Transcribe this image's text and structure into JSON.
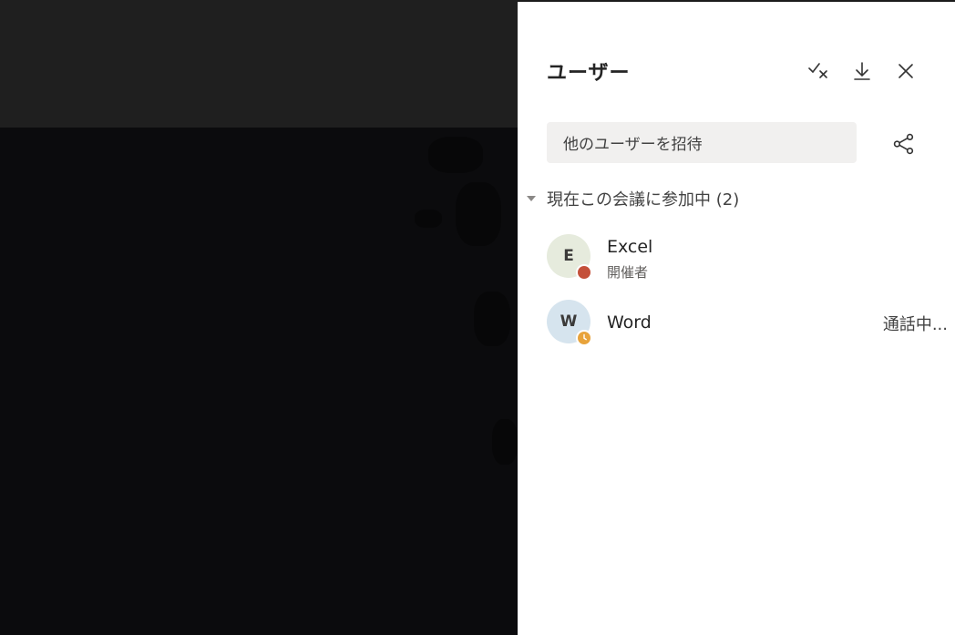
{
  "panel": {
    "title": "ユーザー",
    "actions": [
      "checkmark-x-icon",
      "download-icon",
      "close-icon"
    ],
    "invite_placeholder": "他のユーザーを招待",
    "section_label": "現在この会議に参加中 (2)",
    "participants": [
      {
        "initial": "E",
        "name": "Excel",
        "role": "開催者",
        "status": "",
        "avatar_bg": "#e6ebdd",
        "presence": "busy",
        "presence_color": "#c4503a"
      },
      {
        "initial": "W",
        "name": "Word",
        "role": "",
        "status": "通話中...",
        "avatar_bg": "#d6e4ee",
        "presence": "away",
        "presence_color": "#e8a33b"
      }
    ]
  }
}
